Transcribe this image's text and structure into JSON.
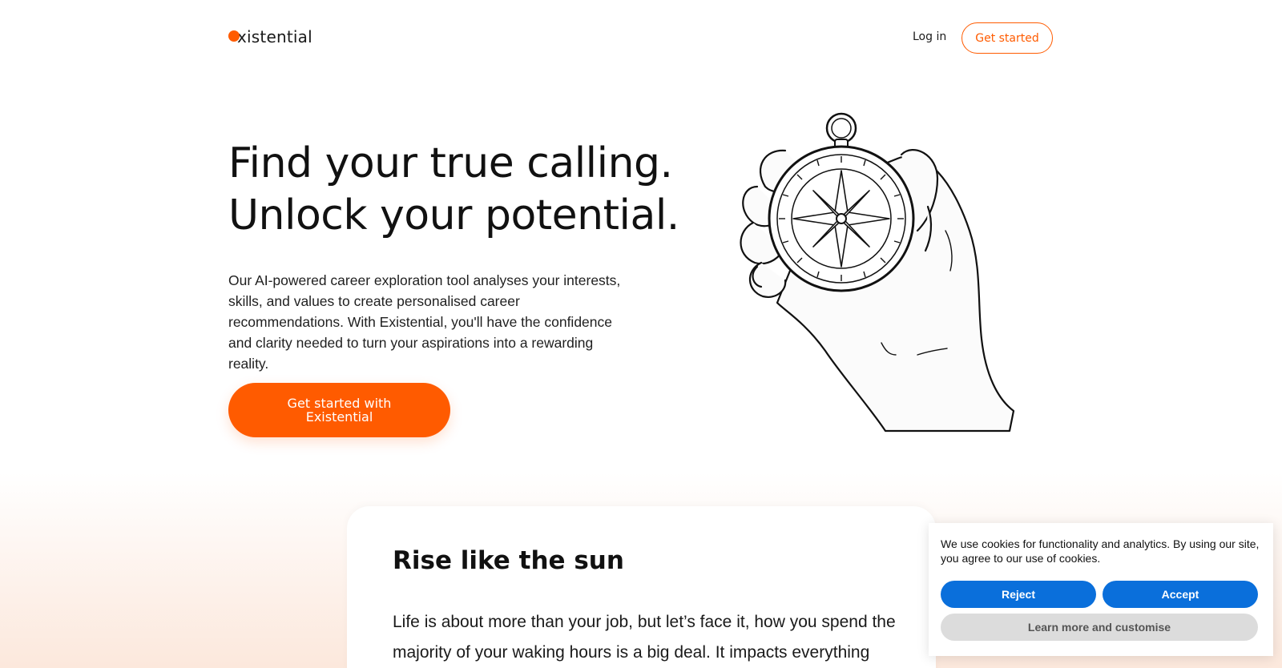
{
  "brand": {
    "logo_text": "xistential",
    "accent_color": "#ff5b00"
  },
  "nav": {
    "login_label": "Log in",
    "get_started_label": "Get started"
  },
  "hero": {
    "title_line1": "Find your true calling.",
    "title_line2": "Unlock your potential.",
    "description": "Our AI-powered career exploration tool analyses your interests, skills, and values to create personalised career recommendations. With Existential, you'll have the confidence and clarity needed to turn your aspirations into a rewarding reality.",
    "cta_label": "Get started with Existential",
    "illustration_icon": "hand-holding-compass-icon"
  },
  "section": {
    "title": "Rise like the sun",
    "text": "Life is about more than your job, but let’s face it, how you spend the majority of your waking hours is a big deal. It impacts everything"
  },
  "cookie_banner": {
    "message": "We use cookies for functionality and analytics. By using our site, you agree to our use of cookies.",
    "reject_label": "Reject",
    "accept_label": "Accept",
    "learn_more_label": "Learn more and customise",
    "button_color": "#0a6fdb"
  }
}
